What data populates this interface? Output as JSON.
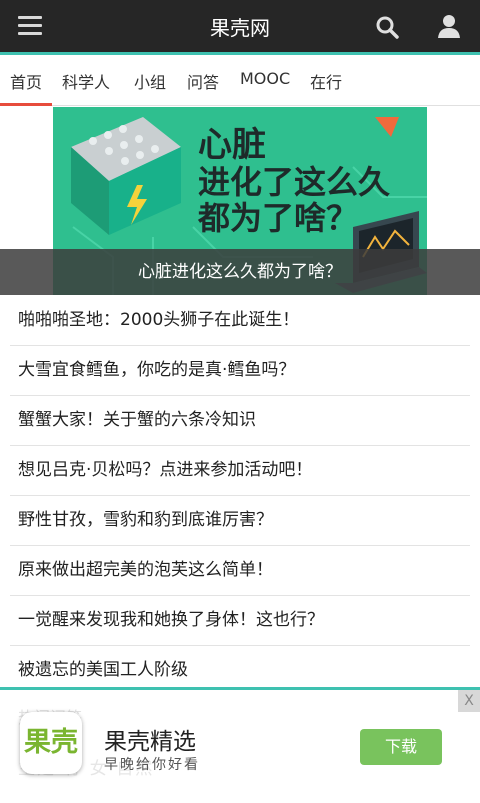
{
  "app": {
    "title": "果壳网"
  },
  "tabs": [
    {
      "label": "首页",
      "active": true
    },
    {
      "label": "科学人"
    },
    {
      "label": "小组"
    },
    {
      "label": "问答"
    },
    {
      "label": "MOOC"
    },
    {
      "label": "在行"
    }
  ],
  "banner": {
    "heading_line1": "心脏",
    "heading_line2": "进化了这么久",
    "heading_line3": "都为了啥？",
    "caption": "心脏进化这么久都为了啥？"
  },
  "articles": [
    "啪啪啪圣地：2000头狮子在此诞生！",
    "大雪宜食鳕鱼，你吃的是真·鳕鱼吗？",
    "蟹蟹大家！关于蟹的六条冷知识",
    "想见吕克·贝松吗？点进来参加活动吧！",
    "野性甘孜，雪豹和豹到底谁厉害？",
    "原来做出超完美的泡芙这么简单！",
    "一觉醒来发现我和她换了身体！这也行？",
    "被遗忘的美国工人阶级"
  ],
  "ad": {
    "close_label": "X",
    "logo_text": "果壳",
    "title": "果壳精选",
    "subtitle": "早晚给你好看",
    "button_label": "下载",
    "background_hint_1": "热门问答",
    "background_hint_2": "主是    有    女    自然"
  },
  "colors": {
    "accent": "#3ec1b0",
    "tab_active": "#e74c3c",
    "topbar": "#262626",
    "download": "#79c35d"
  }
}
